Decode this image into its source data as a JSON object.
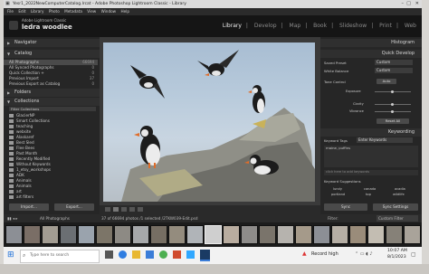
{
  "window": {
    "title": "Yesr1_2022NewComputerCatalog.lrcat - Adobe Photoshop Lightroom Classic - Library",
    "menu": [
      "File",
      "Edit",
      "Library",
      "Photo",
      "Metadata",
      "View",
      "Window",
      "Help"
    ]
  },
  "identity": {
    "line1": "Adobe Lightroom Classic",
    "line2": "ledra woodlee"
  },
  "modules": [
    "Library",
    "Develop",
    "Map",
    "Book",
    "Slideshow",
    "Print",
    "Web"
  ],
  "left": {
    "navigator": "Navigator",
    "catalog": {
      "title": "Catalog",
      "items": [
        {
          "label": "All Photographs",
          "count": "66694"
        },
        {
          "label": "All Synced Photographs",
          "count": "0"
        },
        {
          "label": "Quick Collection +",
          "count": "0"
        },
        {
          "label": "Previous Import",
          "count": "37"
        },
        {
          "label": "Previous Export as Catalog",
          "count": "0"
        }
      ]
    },
    "folders": "Folders",
    "collections": {
      "title": "Collections",
      "items": [
        "Filter Collections",
        "GlacierNP",
        "Smart Collections",
        "teaching",
        "website",
        "Alaskaref",
        "Best Sled",
        "Flee Bees",
        "Past Month",
        "Recently Modified",
        "Without Keywords",
        "1_etsy_workshops",
        "ADK",
        "Animals",
        "Animals",
        "art",
        "art filters"
      ]
    },
    "import_btn": "Import...",
    "export_btn": "Export..."
  },
  "right": {
    "histogram": "Histogram",
    "quick_develop": {
      "title": "Quick Develop",
      "saved_preset": {
        "label": "Saved Preset",
        "value": "Custom"
      },
      "white_balance": {
        "label": "White Balance",
        "value": "Custom"
      },
      "tone_control": {
        "label": "Tone Control",
        "value": "Auto"
      },
      "sliders": [
        "Exposure",
        "Clarity",
        "Vibrance"
      ],
      "reset": "Reset All"
    },
    "keywording": {
      "title": "Keywording",
      "tags_label": "Keyword Tags",
      "tags_value": "Enter Keywords",
      "keywords": "maine, puffins",
      "add_placeholder": "click here to add keywords",
      "suggestions_title": "Keyword Suggestions",
      "suggestions": [
        "lundy",
        "canada",
        "acadia",
        "portland",
        "top",
        "wildlife"
      ]
    },
    "sync": "Sync",
    "sync_settings": "Sync Settings"
  },
  "filmstrip": {
    "source": "All Photographs",
    "status": "37 of 66694 photos /1 selected /2TKW039-Edit.psd",
    "filter_label": "Filter:",
    "filter_value": "Custom Filter"
  },
  "taskbar": {
    "search_placeholder": "Type here to search",
    "weather": "Record high",
    "time": "10:07 AM",
    "date": "8/1/2023"
  }
}
